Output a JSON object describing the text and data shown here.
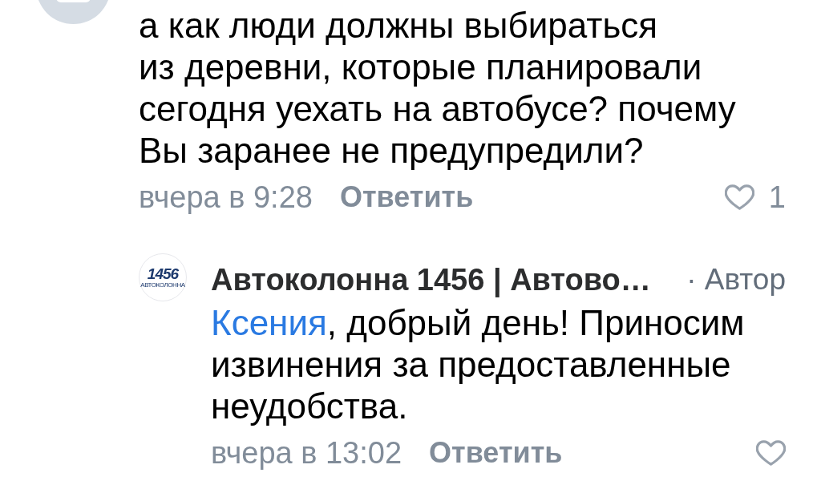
{
  "comments": [
    {
      "avatar": {
        "kind": "placeholder"
      },
      "text": "а как люди должны выбираться\nиз деревни, которые планировали сегодня уехать на автобусе? почему Вы заранее не предупредили?",
      "time": "вчера в 9:28",
      "reply_action": "Ответить",
      "like": {
        "liked": false,
        "count": "1"
      },
      "replies": [
        {
          "avatar": {
            "kind": "logo",
            "logo_text": "1456",
            "logo_caption": "АВТОКОЛОННА"
          },
          "author": "Автоколонна 1456 | Автово…",
          "author_badge": "· Автор",
          "mention": "Ксения",
          "text": ", добрый день! Приносим извинения за предоставленные неудобства.",
          "time": "вчера в 13:02",
          "reply_action": "Ответить",
          "like": {
            "liked": false
          }
        }
      ]
    }
  ]
}
